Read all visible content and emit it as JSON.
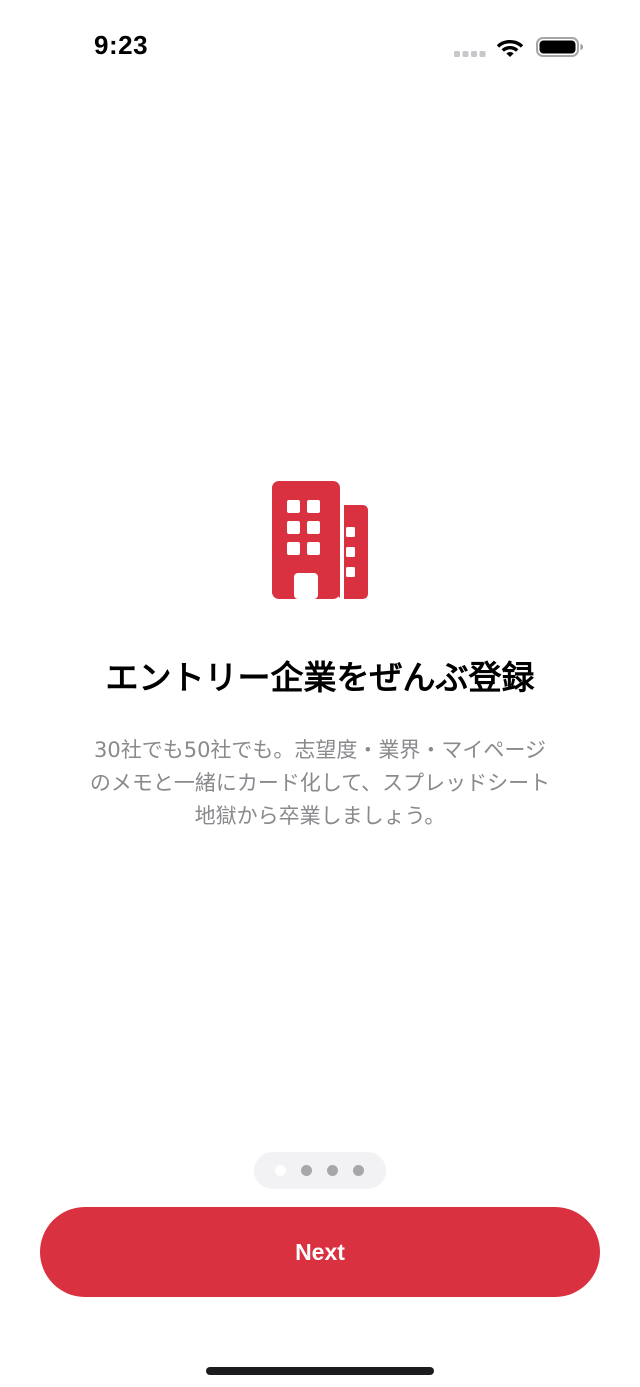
{
  "status_bar": {
    "time": "9:23",
    "signal_icon": "cellular-signal-icon",
    "wifi_icon": "wifi-icon",
    "battery_icon": "battery-icon"
  },
  "hero": {
    "icon": "building-icon",
    "icon_color": "#d93140"
  },
  "onboarding": {
    "title": "エントリー企業をぜんぶ登録",
    "description_lines": [
      "30社でも50社でも。志望度・業界・マイページ",
      "のメモと一緒にカード化して、スプレッドシート",
      "地獄から卒業しましょう。"
    ]
  },
  "pager": {
    "total_pages": 4,
    "current_page": 1
  },
  "footer": {
    "next_label": "Next",
    "accent_color": "#d93140"
  }
}
